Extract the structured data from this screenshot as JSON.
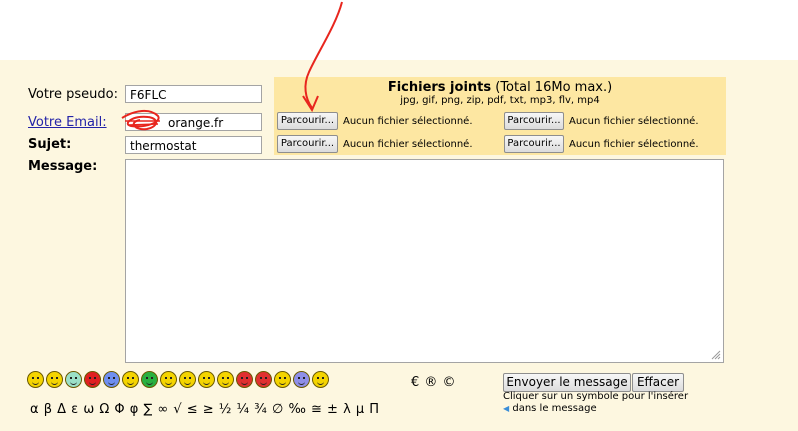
{
  "form": {
    "pseudo_label": "Votre pseudo:",
    "pseudo_value": "F6FLC",
    "email_label": "Votre Email:",
    "email_value": "orange.fr",
    "subject_label": "Sujet:",
    "subject_value": "thermostat",
    "message_label": "Message:"
  },
  "attachments": {
    "title_bold": "Fichiers joints",
    "title_rest": " (Total 16Mo max.)",
    "allowed": "jpg, gif, png, zip, pdf, txt, mp3, flv, mp4",
    "browse_label": "Parcourir...",
    "no_file": "Aucun fichier sélectionné."
  },
  "actions": {
    "send": "Envoyer le message",
    "clear": "Effacer"
  },
  "smileys": [
    "#f4d400",
    "#f4d400",
    "#9be0c8",
    "#e02020",
    "#6f8ff0",
    "#f4d400",
    "#28b040",
    "#f4d400",
    "#f4d400",
    "#f4d400",
    "#f4d400",
    "#e03030",
    "#e03030",
    "#f4d400",
    "#8f8fe8",
    "#f4d400"
  ],
  "symbols_row1": "€ ® ©",
  "symbols_row2": "α β Δ ε ω Ω Φ φ ∑ ∞ √ ≤ ≥ ½ ¼ ¾ ∅ ‰ ≅ ± λ μ Π",
  "hint_line1": "Cliquer sur un symbole pour l'insérer",
  "hint_line2": "dans le message",
  "colors": {
    "panel": "#fdf7e0",
    "attach": "#fde7a2",
    "annotation": "#e8261e",
    "link": "#2323a8"
  }
}
